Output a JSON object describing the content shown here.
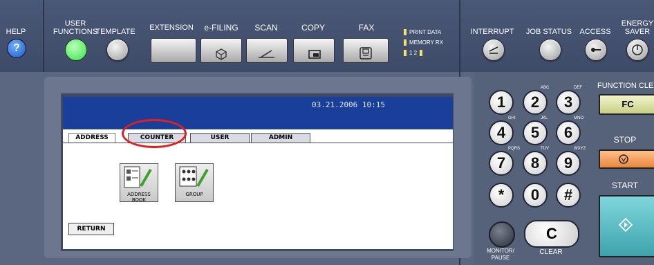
{
  "top": {
    "help": "HELP",
    "user_functions": [
      "USER",
      "FUNCTIONS"
    ],
    "template": "TEMPLATE",
    "extension": "EXTENSION",
    "efiling": "e-FILING",
    "scan": "SCAN",
    "copy": "COPY",
    "fax": "FAX",
    "print_data": "PRINT DATA",
    "memory_rx": "MEMORY RX",
    "line_status": "1 2",
    "interrupt": "INTERRUPT",
    "job_status": "JOB STATUS",
    "access": "ACCESS",
    "energy_saver": [
      "ENERGY",
      "SAVER"
    ]
  },
  "screen": {
    "datetime": "03.21.2006 10:15",
    "tabs": [
      "ADDRESS",
      "COUNTER",
      "USER",
      "ADMIN"
    ],
    "tiles": [
      "ADDRESS BOOK",
      "GROUP"
    ],
    "return": "RETURN"
  },
  "keypad": {
    "keys": [
      "1",
      "2",
      "3",
      "4",
      "5",
      "6",
      "7",
      "8",
      "9",
      "*",
      "0",
      "#"
    ],
    "letters": [
      "ABC",
      "DEF",
      "GHI",
      "JKL",
      "MNO",
      "PQRS",
      "TUV",
      "WXYZ"
    ],
    "function_clear": "FUNCTION CLE",
    "fc": "FC",
    "stop": "STOP",
    "start": "START",
    "monitor_pause": [
      "MONITOR/",
      "PAUSE"
    ],
    "clear": "CLEAR",
    "clear_key": "C"
  },
  "colors": {
    "screen_header": "#193f9a",
    "user_functions_led": "#38e24a",
    "fc_button": "#e8ecb0",
    "stop_button": "#f2a05a",
    "start_button": "#5ec0c8",
    "callout": "#e02020"
  }
}
